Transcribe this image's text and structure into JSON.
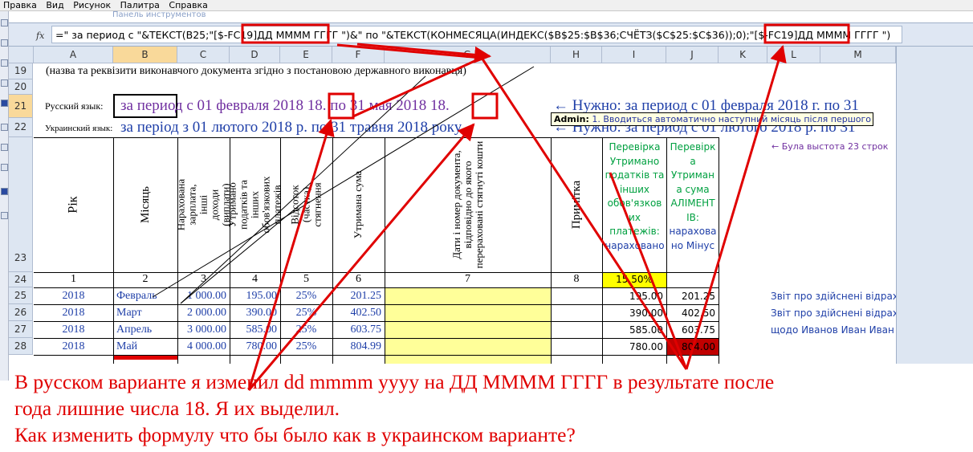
{
  "menu": [
    "Правка",
    "Вид",
    "Рисунок",
    "Палитра",
    "Справка"
  ],
  "faint_title": "Панель инструментов",
  "formula_bar": {
    "fx_label": "fx",
    "formula": "=\" за период с  \"&ТЕКСТ(B25;\"[$-FC19]ДД ММММ ГГГГ \")&\" по \"&ТЕКСТ(КОНМЕСЯЦА(ИНДЕКС($B$25:$B$36;СЧЁТЗ($C$25:$C$36));0);\"[$-FC19]ДД ММММ ГГГГ \")"
  },
  "columns": [
    "A",
    "B",
    "C",
    "D",
    "E",
    "F",
    "G",
    "H",
    "I",
    "J",
    "K",
    "L",
    "M"
  ],
  "rows": [
    "19",
    "20",
    "21",
    "22",
    "23",
    "24",
    "25",
    "26",
    "27",
    "28"
  ],
  "row19": "(назва та реквізити виконавчого документа згідно з постановою державного виконавця)",
  "comment": {
    "author": "Admin:",
    "text": "1. Вводиться автоматично наступний місяць після першого"
  },
  "row21": {
    "label": "Русский язык:",
    "value": "за период с  01 февраля 2018 18.  по 31 мая 2018 18.",
    "needed": "← Нужно: за период с  01 февраля 2018 г.  по 31"
  },
  "row22": {
    "label": "Украинский язык:",
    "value": "за період з  01 лютого 2018 р.  по 31 травня 2018 року",
    "needed": "← Нужно: за период с  01 лютого 2018 р.  по 31"
  },
  "headers23": {
    "year": "Рік",
    "month": "Місяць",
    "accrued": "Нарахована зарплата, інші доходи (виплати)",
    "withheld": "Утримано податків та інших обов'язкових платежів",
    "percent": "Відсоток (частка) стягнення",
    "amount": "Утримана сума",
    "dates": "Дати і номер документа, відповідно до якого перераховані стягнуті кошти",
    "note": "Примітка",
    "check1": [
      "Перевірка",
      "Утримано",
      "податків та",
      "інших",
      "обов'язков",
      "их",
      "платежів:",
      "нараховано"
    ],
    "check2": [
      "Перевірк",
      "а",
      "Утриман",
      "а сума",
      "АЛІМЕНТ",
      "ІВ:",
      "нарахова",
      "но Мінус"
    ],
    "side_note": "← Була выстота 23 строк"
  },
  "row24": {
    "n": [
      "1",
      "2",
      "3",
      "4",
      "5",
      "6",
      "7",
      "8"
    ],
    "pct": "15.50%"
  },
  "data_rows": [
    {
      "year": "2018",
      "month": "Февраль",
      "accrued": "1 000.00",
      "withheld": "195.00",
      "pct": "25%",
      "amount": "201.25",
      "i": "195.00",
      "j": "201.25",
      "l": "Звіт про здійснені відрах"
    },
    {
      "year": "2018",
      "month": "Март",
      "accrued": "2 000.00",
      "withheld": "390.00",
      "pct": "25%",
      "amount": "402.50",
      "i": "390.00",
      "j": "402.50",
      "l": "Звіт про здійснені відрах"
    },
    {
      "year": "2018",
      "month": "Апрель",
      "accrued": "3 000.00",
      "withheld": "585.00",
      "pct": "25%",
      "amount": "603.75",
      "i": "585.00",
      "j": "603.75",
      "l": "щодо Иванов Иван Иван"
    },
    {
      "year": "2018",
      "month": "Май",
      "accrued": "4 000.00",
      "withheld": "780.00",
      "pct": "25%",
      "amount": "804.99",
      "i": "780.00",
      "j": "804.00",
      "l": ""
    }
  ],
  "bottom_text": [
    "В русском варианте я изменил dd mmmm yyyy на ДД ММММ ГГГГ в результате после",
    "года лишние числа 18. Я их выделил.",
    "Как изменить формулу что бы было как в украинском варианте?"
  ],
  "colors": {
    "accent_red": "#e00000",
    "russian_text": "#7030a0",
    "ukrainian_text": "#1f3fa8",
    "check_green": "#00a040",
    "yellow_fill": "#ffff99"
  }
}
